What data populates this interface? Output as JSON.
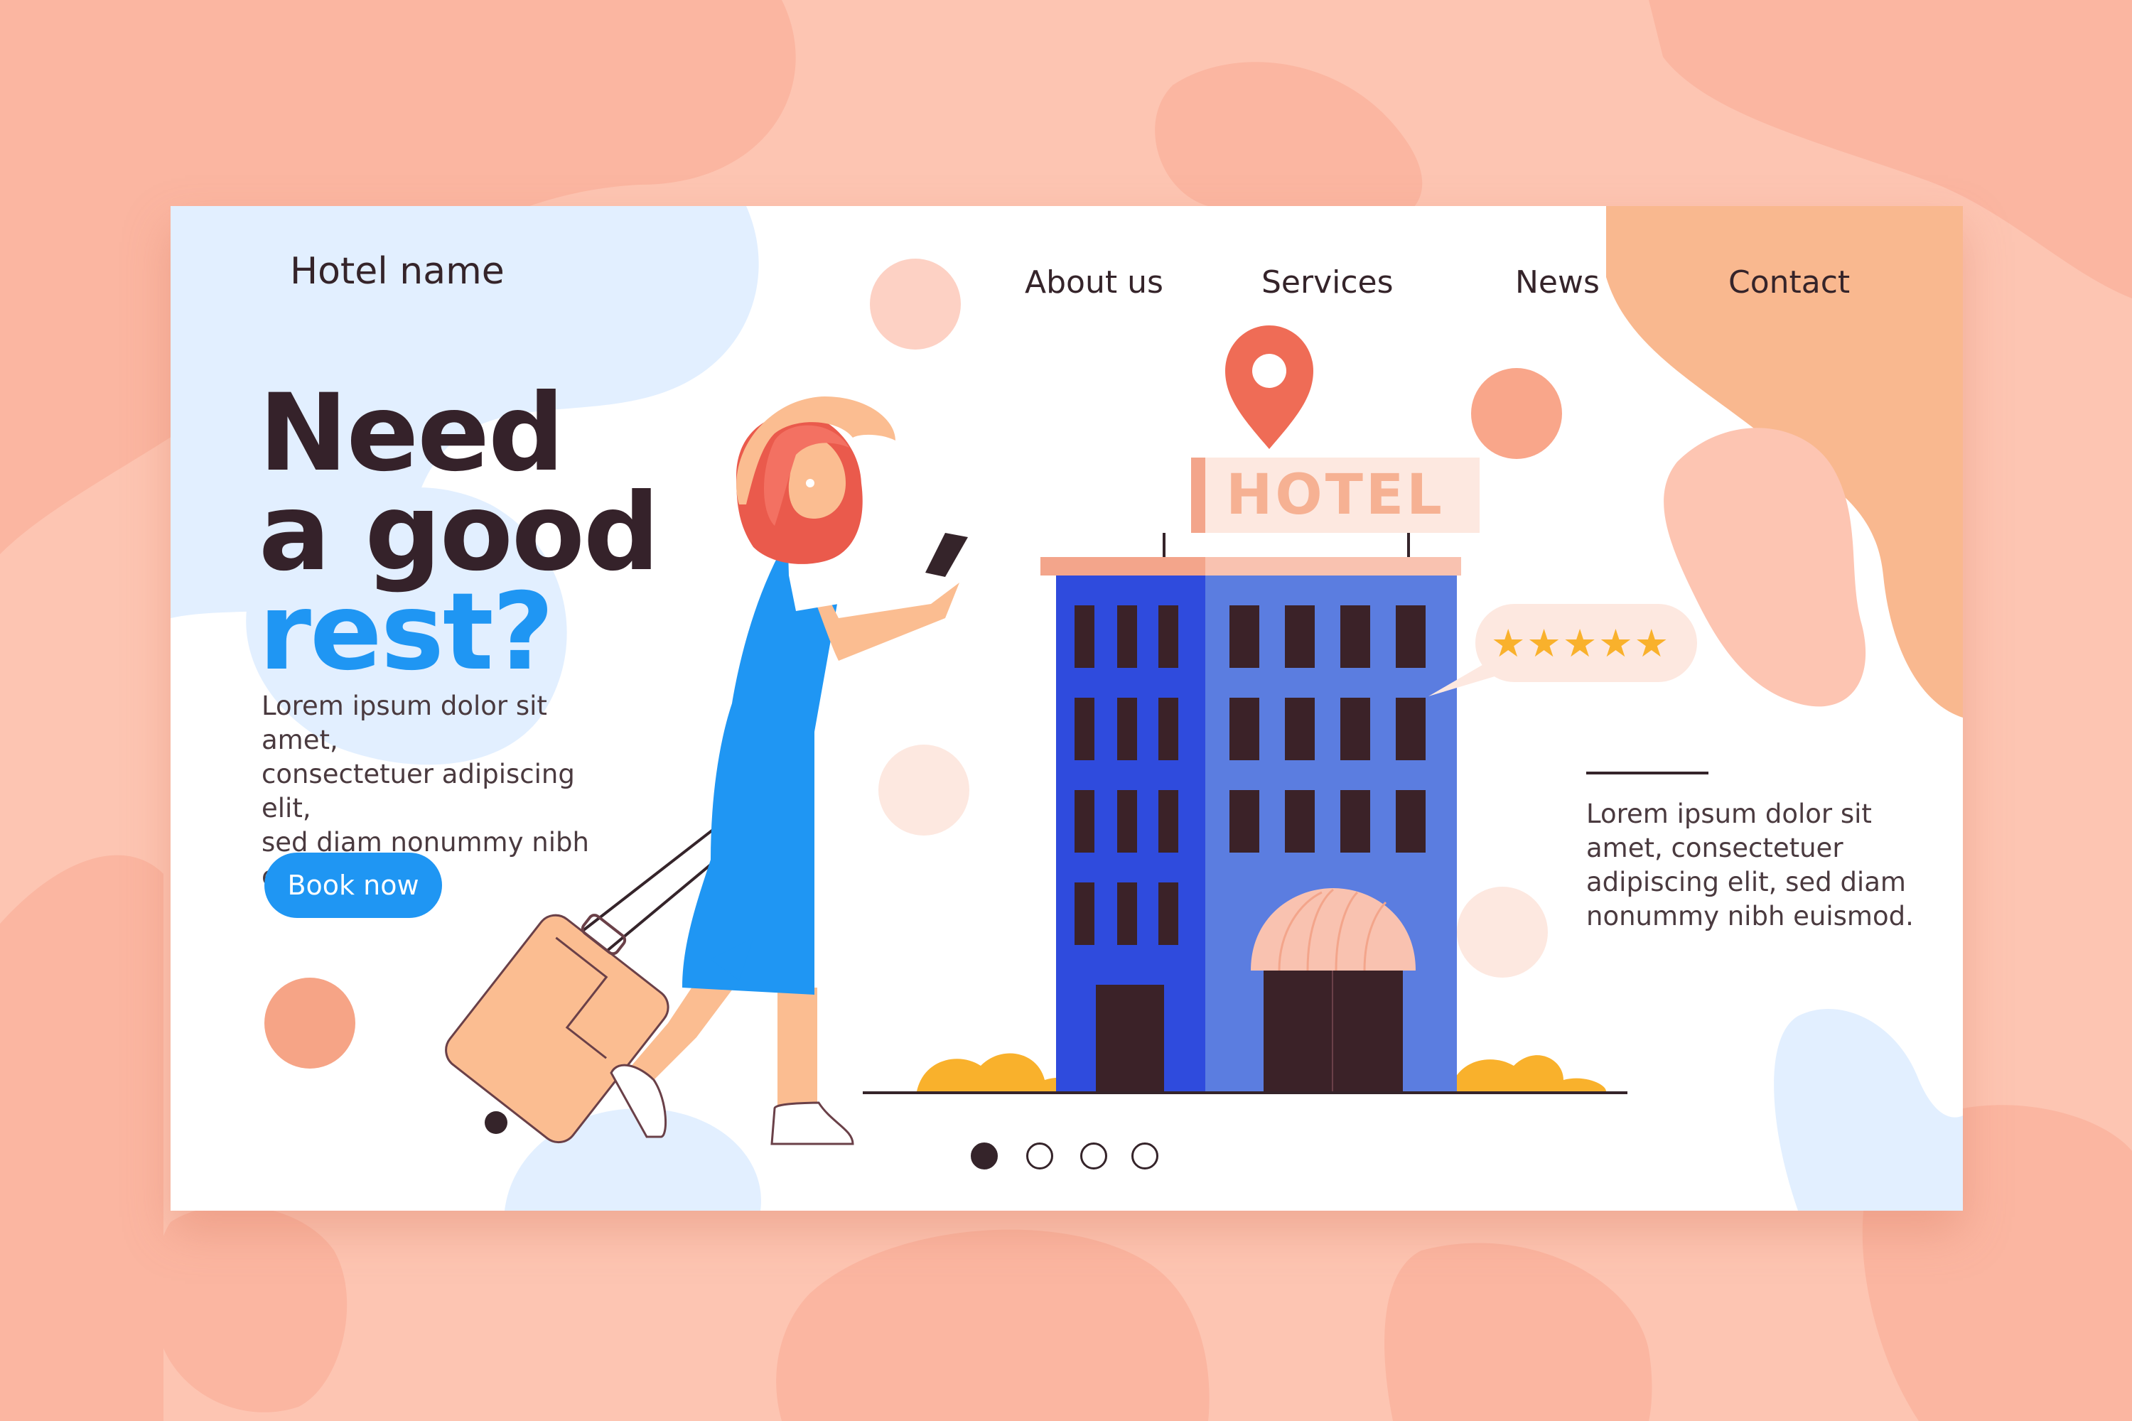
{
  "brand": "Hotel name",
  "nav": [
    "About us",
    "Services",
    "News",
    "Contact"
  ],
  "hero": {
    "line1": "Need",
    "line2": "a good",
    "line3": "rest?",
    "description": "Lorem ipsum dolor sit amet,\nconsectetuer adipiscing elit,\nsed diam nonummy nibh\neuismod.",
    "cta": "Book now"
  },
  "side_text": "Lorem ipsum dolor sit\namet, consectetuer\nadipiscing elit, sed diam\nnonummy nibh euismod.",
  "hotel_sign": "HOTEL",
  "rating": "★★★★★",
  "slider": {
    "count": 4,
    "active": 0
  },
  "colors": {
    "accent": "#1f96f3",
    "dark": "#35242a",
    "peach": "#fdc5b2",
    "building": "#3d59d6"
  }
}
